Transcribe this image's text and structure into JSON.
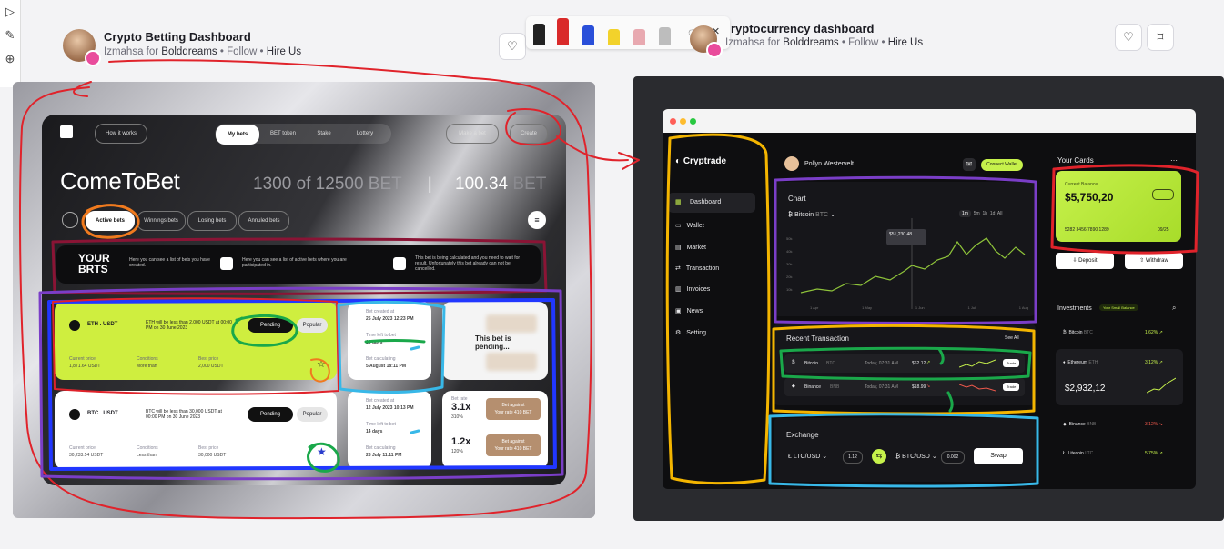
{
  "toolrail": {
    "icons": [
      "cursor-icon",
      "pen-icon",
      "add-icon"
    ]
  },
  "left_shot": {
    "title": "Crypto Betting Dashboard",
    "author": "Izmahsa",
    "for_text": "for",
    "team": "Bolddreams",
    "sep": "•",
    "follow": "Follow",
    "hire": "Hire Us"
  },
  "right_shot": {
    "title": "ryptocurrency dashboard",
    "author": "Izmahsa",
    "for_text": "for",
    "team": "Bolddreams",
    "sep": "•",
    "follow": "Follow",
    "hire": "Hire Us"
  },
  "betting": {
    "nav": {
      "how": "How it works",
      "tabs": [
        "My bets",
        "BET token",
        "Stake",
        "Lottery"
      ],
      "make": "Make a bet",
      "create": "Create"
    },
    "brand": "ComeToBet",
    "balance": {
      "current": "1300",
      "of": "of 12500 BET",
      "sep": "|",
      "value": "100.34",
      "unit": "BET"
    },
    "filters": [
      "Active bets",
      "Winnings bets",
      "Losing bets",
      "Annuled bets"
    ],
    "info": {
      "title_l1": "YOUR",
      "title_l2": "BRTS",
      "text1": "Here you can see a list of bets you have created.",
      "text2": "Here you can see a list of active bets where you are participated in.",
      "text3": "This bet is being calculated and you need to wait for result. Unfortunately this bet already can not be cancelled."
    },
    "bets": [
      {
        "pair": "ETH . USDT",
        "cond": "ETH will be less than 2,000 USDT at 00:00 PM on 30 June 2023",
        "status": "Pending",
        "tag": "Popular",
        "price_label": "Current price",
        "price": "1,871.64 USDT",
        "cond_label": "Conditions",
        "cond_val": "More than",
        "best_label": "Best price",
        "best": "2,000 USDT"
      },
      {
        "pair": "BTC . USDT",
        "cond": "BTC will be less than 30,000 USDT at 00:00 PM on 30 June 2023",
        "status": "Pending",
        "tag": "Popular",
        "price_label": "Current price",
        "price": "30,233.54 USDT",
        "cond_label": "Conditions",
        "cond_val": "Less than",
        "best_label": "Best price",
        "best": "30,000 USDT"
      }
    ],
    "timing": [
      {
        "created_label": "Bet created at",
        "created": "25 July 2023 12:23 PM",
        "left_label": "Time left to bet",
        "left": "13 days",
        "calc_label": "Bet calculating",
        "calc": "5 August 18:11 PM"
      },
      {
        "created_label": "Bet created at",
        "created": "12 July 2023 10:13 PM",
        "left_label": "Time left to bet",
        "left": "14 days",
        "calc_label": "Bet calculating",
        "calc": "28 July 11:11 PM"
      }
    ],
    "pending_card": "This bet is pending...",
    "odds": {
      "label": "Bet rate",
      "v1": "3.1x",
      "p1": "310%",
      "v2": "1.2x",
      "p2": "120%",
      "btn": "Bet against",
      "btn_sub": "Your rate 410 BET"
    }
  },
  "crypto": {
    "brand": "Cryptrade",
    "nav": [
      "Dashboard",
      "Wallet",
      "Market",
      "Transaction",
      "Invoices",
      "News",
      "Setting"
    ],
    "user": "Pollyn Westervelt",
    "connect": "Connect Wallet",
    "chart": {
      "title": "Chart",
      "coin": "Bitcoin",
      "ticker": "BTC",
      "ranges": [
        "1m",
        "5m",
        "1h",
        "1d",
        "All"
      ],
      "tooltip": "$51,230.48",
      "y": [
        "50k",
        "40k",
        "30k",
        "20k",
        "10k",
        "0k"
      ],
      "x": [
        "1 Apr",
        "1 May",
        "1 Jun",
        "1 Jul",
        "1 Aug"
      ]
    },
    "recent": {
      "title": "Recent Transaction",
      "see_all": "See All",
      "rows": [
        {
          "coin": "Bitcoin",
          "ticker": "BTC",
          "time": "Today, 07:31 AM",
          "amount": "$62.12",
          "btn": "Trade"
        },
        {
          "coin": "Binance",
          "ticker": "BNB",
          "time": "Today, 07:31 AM",
          "amount": "$18.99",
          "btn": "Trade"
        }
      ]
    },
    "exchange": {
      "title": "Exchange",
      "from": "LTC/USD",
      "from_val": "1.12",
      "to": "BTC/USD",
      "to_val": "0.002",
      "btn": "Swap"
    },
    "cards": {
      "title": "Your Cards",
      "label": "Current Balance",
      "balance": "$5,750,20",
      "number": "5282 3456 7890 1289",
      "exp": "09/25",
      "deposit": "Deposit",
      "withdraw": "Withdraw"
    },
    "investments": {
      "title": "Investments",
      "chip": "Your Small Balance",
      "rows": [
        {
          "coin": "Bitcoin",
          "ticker": "BTC",
          "pct": "1.62% ↗"
        },
        {
          "coin": "Ethereum",
          "ticker": "ETH",
          "pct": "3.12% ↗",
          "value": "$2,932,12"
        },
        {
          "coin": "Binance",
          "ticker": "BNB",
          "pct": "3.12% ↘"
        },
        {
          "coin": "Litecoin",
          "ticker": "LTC",
          "pct": "5.75% ↗"
        }
      ]
    }
  },
  "colors": {
    "lime": "#c6f14b",
    "annotation_red": "#e0232b",
    "annotation_blue": "#2137ff",
    "annotation_purple": "#7a3ec7",
    "annotation_green": "#1aa84a",
    "annotation_orange": "#f07a1e",
    "annotation_cyan": "#38b8e8",
    "annotation_yellow": "#f4b500"
  }
}
